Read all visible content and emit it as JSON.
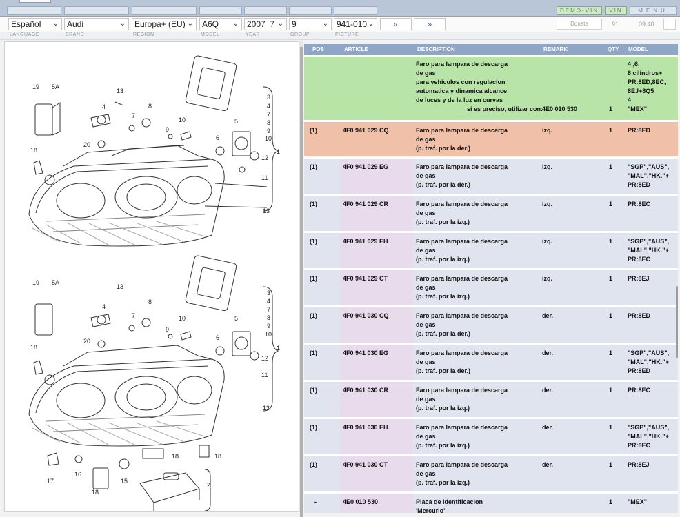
{
  "toolbar": {
    "demo_vin_label": "DEMO-VIN",
    "vin_label": "VIN",
    "menu_label": "MENU"
  },
  "selectors": {
    "language": "Español",
    "brand": "Audi",
    "region": "Europa+ (EU)",
    "model": "A6Q",
    "year": "2007",
    "year_sub": "7",
    "group": "9",
    "picture": "941-010",
    "prev_label": "«",
    "next_label": "»",
    "donate_label": "Donate",
    "count": "91",
    "time": "09:40"
  },
  "labels": {
    "language": "LANGUAGE",
    "brand": "BRAND",
    "region": "REGION",
    "model": "MODEL",
    "year": "YEAR",
    "group": "GROUP",
    "picture": "PICTURE"
  },
  "table": {
    "headers": {
      "pos": "POS",
      "article": "ARTICLE",
      "description": "DESCRIPTION",
      "remark": "REMARK",
      "qty": "QTY",
      "model": "MODEL"
    },
    "rows": [
      {
        "pos": "",
        "article": "",
        "desc": "Faro para lampara de descarga\nde gas\npara vehiculos con regulacion\nautomatica y dinamica alcance\nde luces y de la luz en curvas",
        "desc_extra": "si es preciso, utilizar con:",
        "remark": "4E0 010 530",
        "qty": "1",
        "model": "4 ,6,\n8 cilindros+\nPR:8ED,8EC,\n8EJ+8Q5\n4\n\"MEX\""
      },
      {
        "pos": "(1)",
        "article": "4F0 941 029 CQ",
        "desc": "Faro para lampara de descarga\nde gas\n(p. traf. por la der.)",
        "remark": "izq.",
        "qty": "1",
        "model": "PR:8ED"
      },
      {
        "pos": "(1)",
        "article": "4F0 941 029 EG",
        "desc": "Faro para lampara de descarga\nde gas\n(p. traf. por la der.)",
        "remark": "izq.",
        "qty": "1",
        "model": "\"SGP\",\"AUS\",\n\"MAL\",\"HK.\"+\nPR:8ED"
      },
      {
        "pos": "(1)",
        "article": "4F0 941 029 CR",
        "desc": "Faro para lampara de descarga\nde gas\n(p. traf. por la izq.)",
        "remark": "izq.",
        "qty": "1",
        "model": "PR:8EC"
      },
      {
        "pos": "(1)",
        "article": "4F0 941 029 EH",
        "desc": "Faro para lampara de descarga\nde gas\n(p. traf. por la izq.)",
        "remark": "izq.",
        "qty": "1",
        "model": "\"SGP\",\"AUS\",\n\"MAL\",\"HK.\"+\nPR:8EC"
      },
      {
        "pos": "(1)",
        "article": "4F0 941 029 CT",
        "desc": "Faro para lampara de descarga\nde gas\n(p. traf. por la izq.)",
        "remark": "izq.",
        "qty": "1",
        "model": "PR:8EJ"
      },
      {
        "pos": "(1)",
        "article": "4F0 941 030 CQ",
        "desc": "Faro para lampara de descarga\nde gas\n(p. traf. por la der.)",
        "remark": "der.",
        "qty": "1",
        "model": "PR:8ED"
      },
      {
        "pos": "(1)",
        "article": "4F0 941 030 EG",
        "desc": "Faro para lampara de descarga\nde gas\n(p. traf. por la der.)",
        "remark": "der.",
        "qty": "1",
        "model": "\"SGP\",\"AUS\",\n\"MAL\",\"HK.\"+\nPR:8ED"
      },
      {
        "pos": "(1)",
        "article": "4F0 941 030 CR",
        "desc": "Faro para lampara de descarga\nde gas\n(p. traf. por la izq.)",
        "remark": "der.",
        "qty": "1",
        "model": "PR:8EC"
      },
      {
        "pos": "(1)",
        "article": "4F0 941 030 EH",
        "desc": "Faro para lampara de descarga\nde gas\n(p. traf. por la izq.)",
        "remark": "der.",
        "qty": "1",
        "model": "\"SGP\",\"AUS\",\n\"MAL\",\"HK.\"+\nPR:8EC"
      },
      {
        "pos": "(1)",
        "article": "4F0 941 030 CT",
        "desc": "Faro para lampara de descarga\nde gas\n(p. traf. por la izq.)",
        "remark": "der.",
        "qty": "1",
        "model": "PR:8EJ"
      },
      {
        "pos": "-",
        "article": "4E0 010 530",
        "desc": "Placa de identificacion\n'Mercurio'",
        "remark": "",
        "qty": "1",
        "model": "\"MEX\""
      }
    ]
  },
  "diagram": {
    "callouts_top": [
      "19",
      "5A",
      "13",
      "4",
      "8",
      "7",
      "9",
      "10",
      "20",
      "5",
      "6",
      "18",
      "12",
      "11",
      "3",
      "4",
      "7",
      "8",
      "9",
      "10",
      "1",
      "13"
    ],
    "callouts_bottom": [
      "19",
      "5A",
      "13",
      "4",
      "8",
      "7",
      "9",
      "10",
      "20",
      "5",
      "6",
      "18",
      "12",
      "11",
      "3",
      "4",
      "7",
      "8",
      "9",
      "10",
      "1",
      "13",
      "18",
      "18",
      "17",
      "16",
      "15",
      "18",
      "2"
    ]
  },
  "colors": {
    "header": "#8fa6c7",
    "row_default": "#dfe4ee",
    "row_selected": "#f0c0a8",
    "row_highlight": "#b9e4a8",
    "article_bg": "#e8dcec"
  }
}
